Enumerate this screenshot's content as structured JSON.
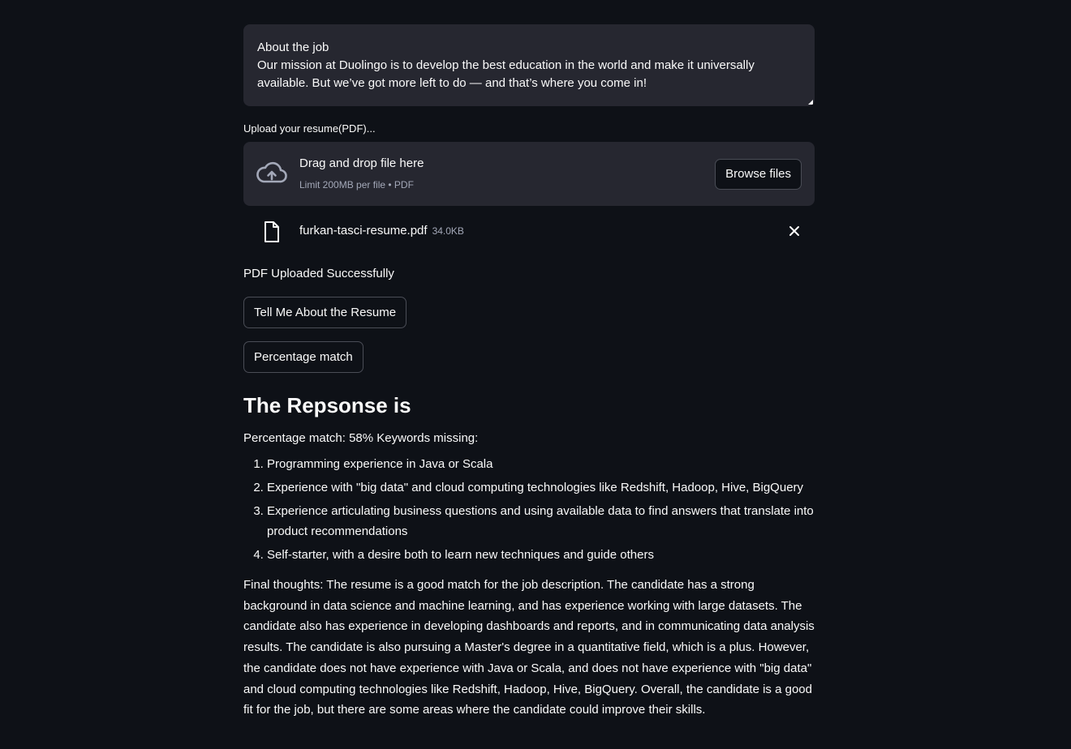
{
  "job_description": {
    "line1": "About the job",
    "line2": "Our mission at Duolingo is to develop the best education in the world and make it universally",
    "line3": "available. But we’ve got more left to do — and that’s where you come in!"
  },
  "uploader": {
    "label": "Upload your resume(PDF)...",
    "drop_title": "Drag and drop file here",
    "drop_limit": "Limit 200MB per file • PDF",
    "browse_label": "Browse files",
    "file_name": "furkan-tasci-resume.pdf",
    "file_size": "34.0KB"
  },
  "status": "PDF Uploaded Successfully",
  "buttons": {
    "tell_me": "Tell Me About the Resume",
    "percentage": "Percentage match"
  },
  "response": {
    "heading": "The Repsonse is",
    "summary": "Percentage match: 58% Keywords missing:",
    "keywords": [
      "Programming experience in Java or Scala",
      "Experience with \"big data\" and cloud computing technologies like Redshift, Hadoop, Hive, BigQuery",
      "Experience articulating business questions and using available data to find answers that translate into product recommendations",
      "Self-starter, with a desire both to learn new techniques and guide others"
    ],
    "final": "Final thoughts: The resume is a good match for the job description. The candidate has a strong background in data science and machine learning, and has experience working with large datasets. The candidate also has experience in developing dashboards and reports, and in communicating data analysis results. The candidate is also pursuing a Master's degree in a quantitative field, which is a plus. However, the candidate does not have experience with Java or Scala, and does not have experience with \"big data\" and cloud computing technologies like Redshift, Hadoop, Hive, BigQuery. Overall, the candidate is a good fit for the job, but there are some areas where the candidate could improve their skills."
  },
  "icons": {
    "upload": "cloud-upload-icon",
    "file": "file-icon",
    "remove": "close-icon"
  }
}
